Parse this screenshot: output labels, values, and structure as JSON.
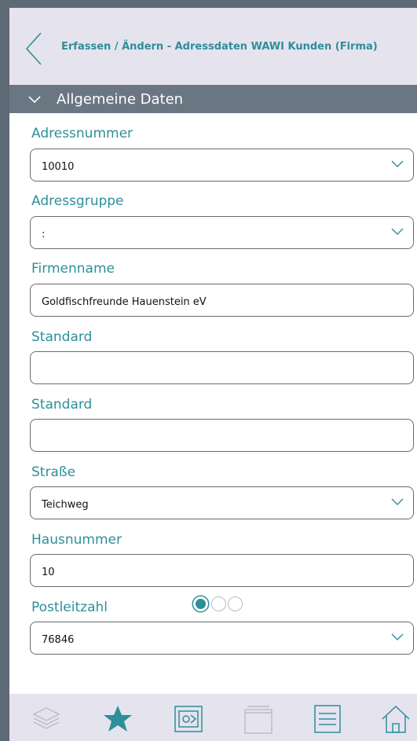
{
  "header": {
    "title": "Erfassen / Ändern - Adressdaten WAWI Kunden (Firma)"
  },
  "section": {
    "title": "Allgemeine Daten"
  },
  "fields": [
    {
      "label": "Adressnummer",
      "value": "10010",
      "dropdown": true
    },
    {
      "label": "Adressgruppe",
      "value": ":",
      "dropdown": true
    },
    {
      "label": "Firmenname",
      "value": "Goldfischfreunde Hauenstein eV",
      "dropdown": false
    },
    {
      "label": "Standard",
      "value": "",
      "dropdown": false
    },
    {
      "label": "Standard",
      "value": "",
      "dropdown": false
    },
    {
      "label": "Straße",
      "value": "Teichweg",
      "dropdown": true
    },
    {
      "label": "Hausnummer",
      "value": "10",
      "dropdown": false
    },
    {
      "label": "Postleitzahl",
      "value": "76846",
      "dropdown": true
    }
  ],
  "pager": {
    "pages": 3,
    "current": 1
  },
  "tabs": [
    {
      "icon": "layers-icon",
      "active": false
    },
    {
      "icon": "star-icon",
      "active": true
    },
    {
      "icon": "settings-screen-icon",
      "active": false
    },
    {
      "icon": "window-icon",
      "active": false
    },
    {
      "icon": "list-icon",
      "active": false
    },
    {
      "icon": "home-icon",
      "active": false
    }
  ],
  "colors": {
    "accent": "#2d8f9a",
    "header_bg": "#e5e3ee",
    "section_bg": "#6b7683",
    "frame": "#5e6976"
  }
}
